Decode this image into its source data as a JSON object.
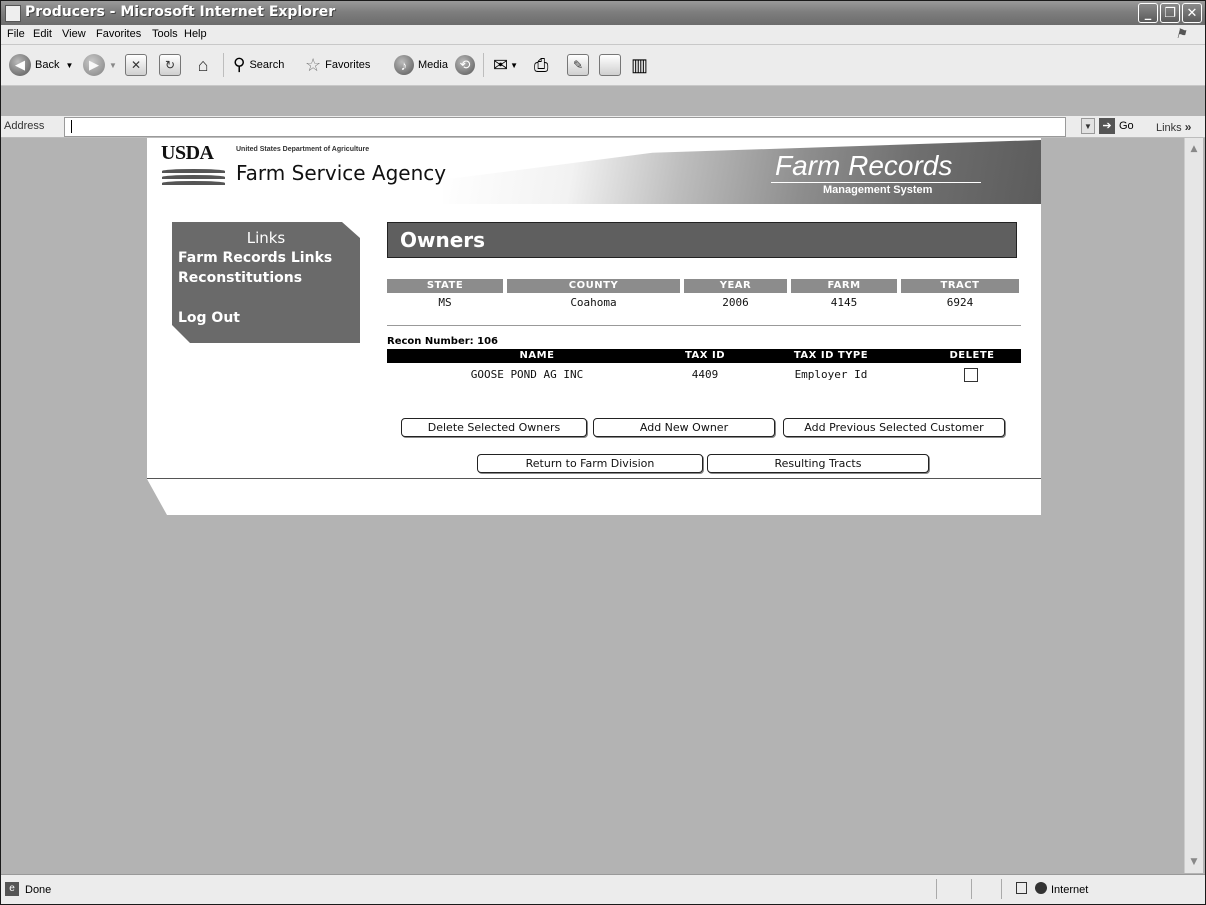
{
  "window": {
    "title": "Producers - Microsoft Internet Explorer"
  },
  "menu": [
    "File",
    "Edit",
    "View",
    "Favorites",
    "Tools",
    "Help"
  ],
  "toolbar": {
    "back": "Back",
    "search": "Search",
    "favorites": "Favorites",
    "media": "Media"
  },
  "address": {
    "label": "Address",
    "go": "Go",
    "links": "Links",
    "more": "»"
  },
  "banner": {
    "usda": "USDA",
    "dept": "United States Department of Agriculture",
    "agency": "Farm Service Agency",
    "app_title": "Farm Records",
    "app_subtitle": "Management System"
  },
  "sidebar": {
    "title": "Links",
    "items": [
      "Farm Records Links",
      "Reconstitutions",
      "Log Out"
    ]
  },
  "page": {
    "heading": "Owners"
  },
  "farm_info": {
    "headers": [
      "STATE",
      "COUNTY",
      "YEAR",
      "FARM",
      "TRACT"
    ],
    "values": [
      "MS",
      "Coahoma",
      "2006",
      "4145",
      "6924"
    ]
  },
  "recon": {
    "label": "Recon Number: 106"
  },
  "owners_table": {
    "headers": [
      "NAME",
      "TAX ID",
      "TAX ID TYPE",
      "DELETE"
    ],
    "rows": [
      {
        "name": "GOOSE POND AG INC",
        "tax_id": "4409",
        "tax_id_type": "Employer Id"
      }
    ]
  },
  "buttons": {
    "delete_selected": "Delete Selected Owners",
    "add_new": "Add New Owner",
    "add_previous": "Add Previous Selected Customer",
    "return_farm": "Return to Farm Division",
    "resulting_tracts": "Resulting Tracts"
  },
  "status": {
    "text": "Done",
    "zone": "Internet"
  }
}
